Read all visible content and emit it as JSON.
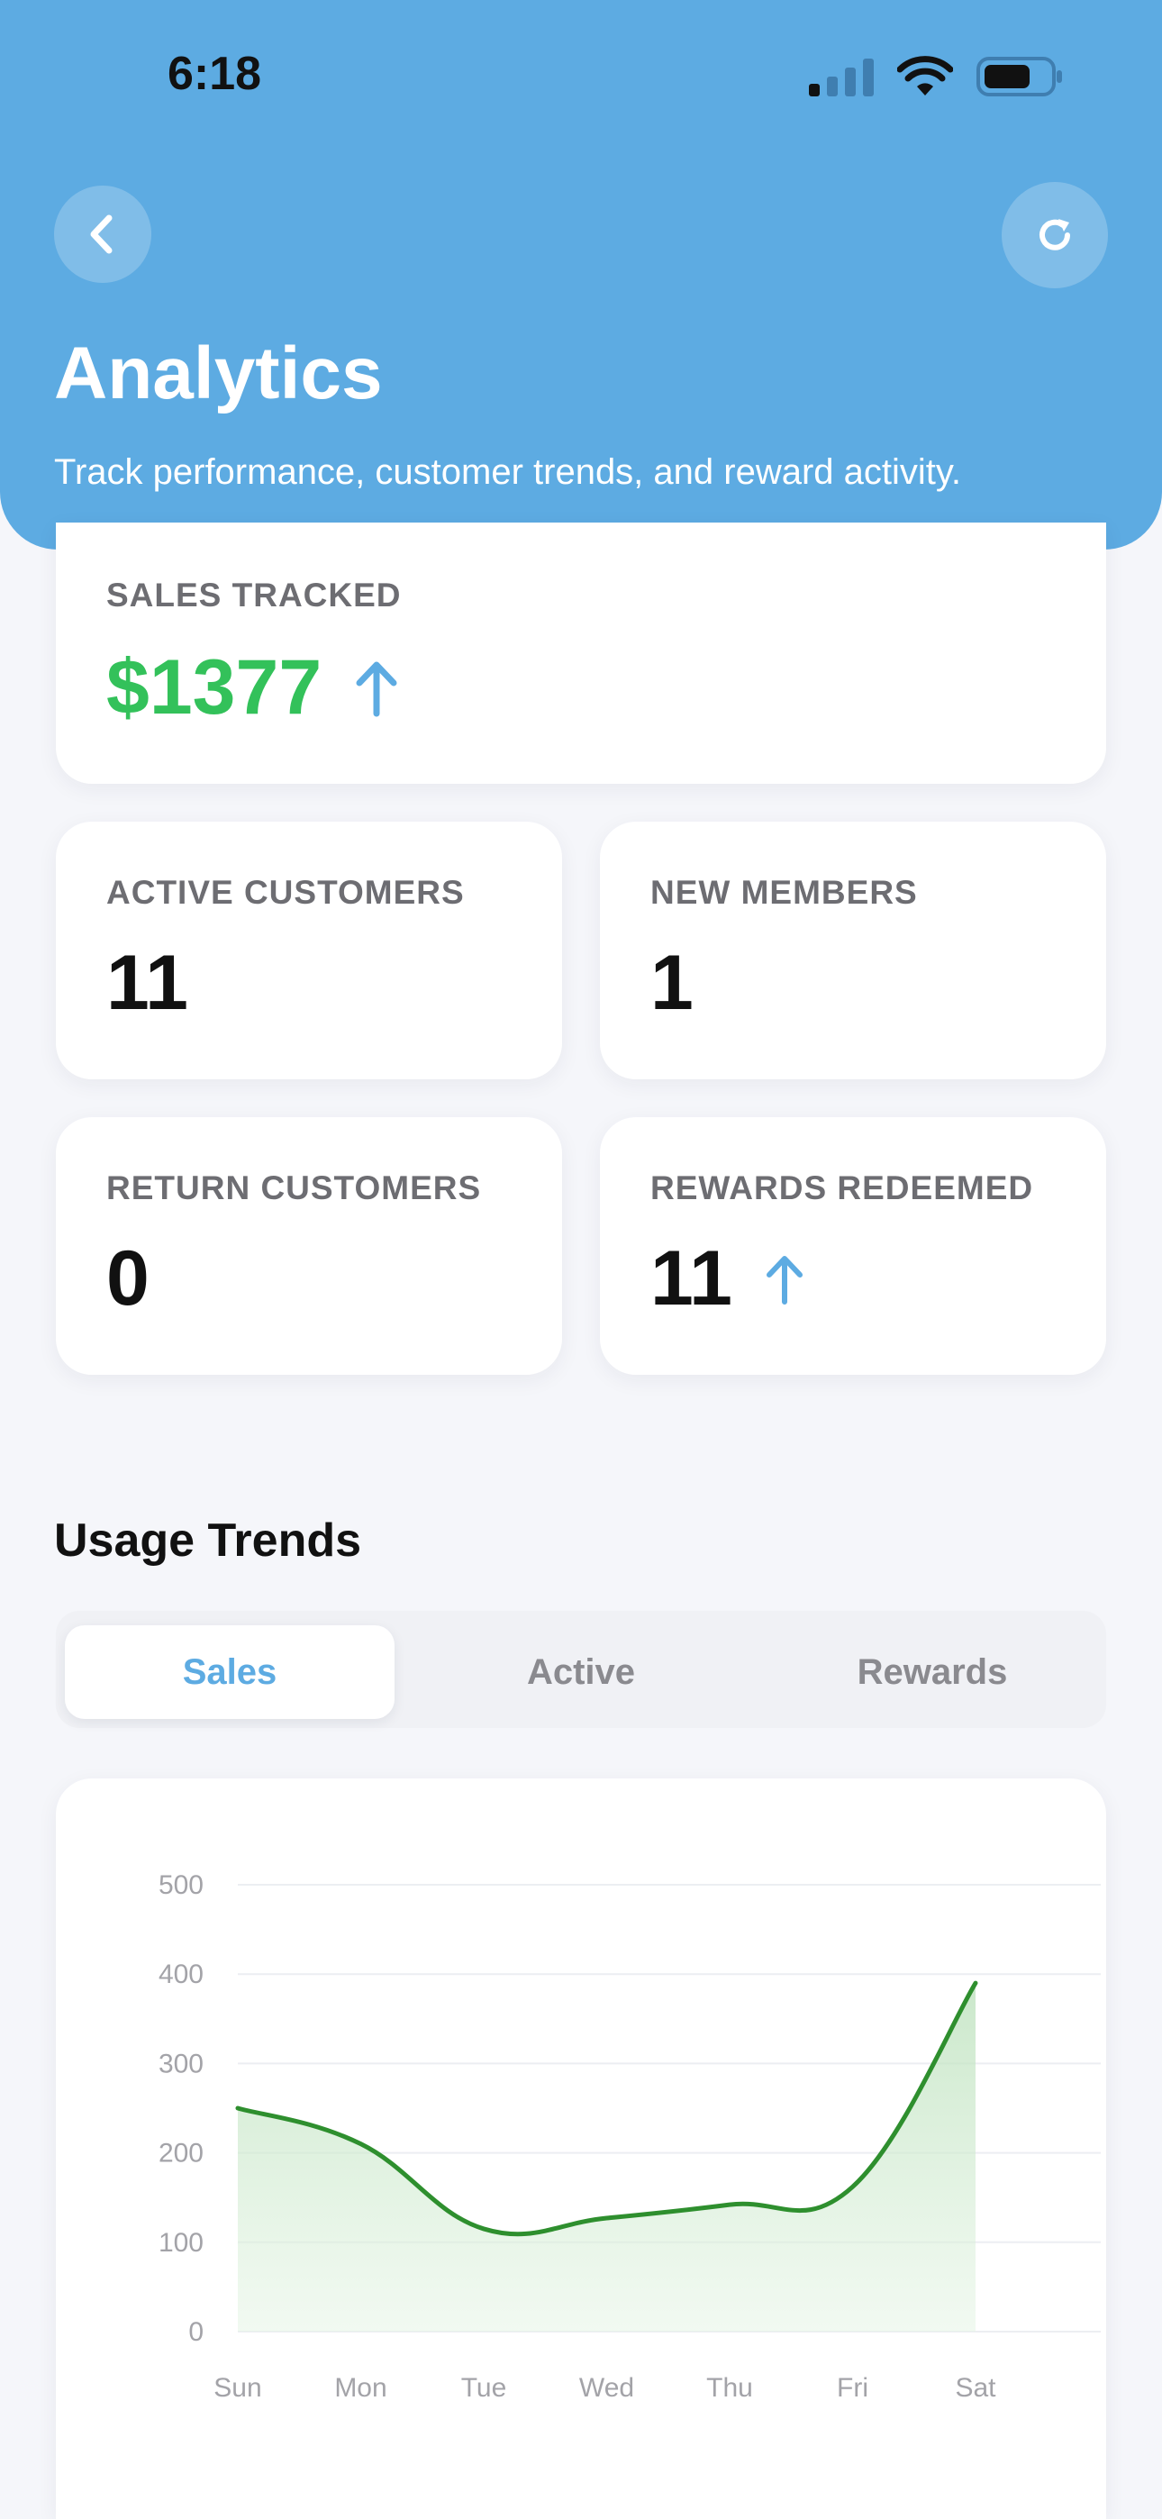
{
  "status_bar": {
    "time": "6:18"
  },
  "header": {
    "title": "Analytics",
    "subtitle": "Track performance, customer trends, and reward activity."
  },
  "colors": {
    "header_blue": "#5dabe2",
    "accent_green": "#33c15a",
    "line_green": "#2e8f2e"
  },
  "sales": {
    "label": "SALES TRACKED",
    "value": "$1377",
    "trend": "up"
  },
  "stats": [
    {
      "label": "ACTIVE CUSTOMERS",
      "value": "11",
      "trend": ""
    },
    {
      "label": "NEW MEMBERS",
      "value": "1",
      "trend": ""
    },
    {
      "label": "RETURN CUSTOMERS",
      "value": "0",
      "trend": ""
    },
    {
      "label": "REWARDS REDEEMED",
      "value": "11",
      "trend": "up"
    }
  ],
  "usage": {
    "title": "Usage Trends",
    "tabs": [
      {
        "label": "Sales",
        "active": true
      },
      {
        "label": "Active",
        "active": false
      },
      {
        "label": "Rewards",
        "active": false
      }
    ]
  },
  "icons": [
    "chevron-left-icon",
    "refresh-icon",
    "signal-icon",
    "wifi-icon",
    "battery-icon",
    "arrow-up-icon"
  ],
  "chart_data": {
    "type": "area",
    "categories": [
      "Sun",
      "Mon",
      "Tue",
      "Wed",
      "Thu",
      "Fri",
      "Sat"
    ],
    "values": [
      250,
      210,
      115,
      127,
      142,
      162,
      390
    ],
    "yticks": [
      0,
      100,
      200,
      300,
      400,
      500
    ],
    "ylim": [
      0,
      500
    ],
    "grid": true
  }
}
